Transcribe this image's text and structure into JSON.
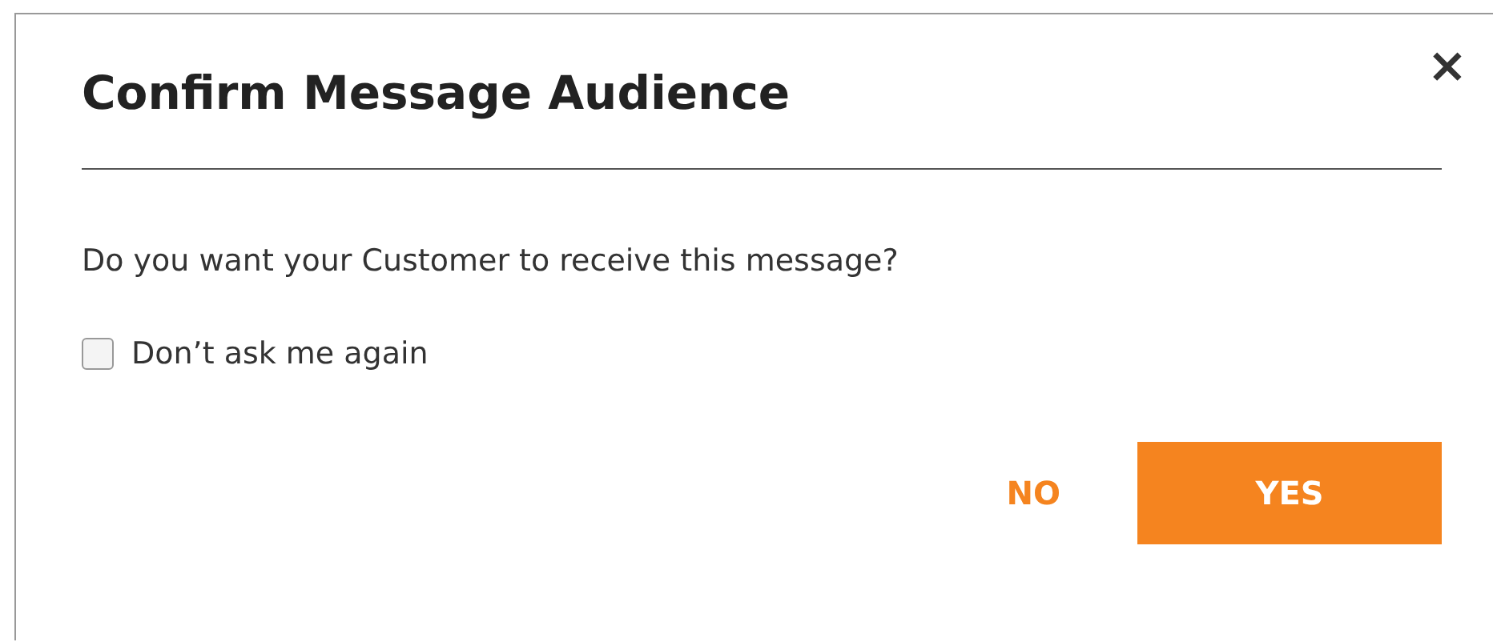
{
  "dialog": {
    "title": "Confirm Message Audience",
    "close": "×",
    "message": "Do you want your Customer to receive this message?",
    "checkbox": {
      "label": "Don’t ask me again",
      "checked": false
    },
    "buttons": [
      {
        "label": "NO",
        "kind": "text"
      },
      {
        "label": "YES",
        "kind": "primary"
      }
    ]
  }
}
